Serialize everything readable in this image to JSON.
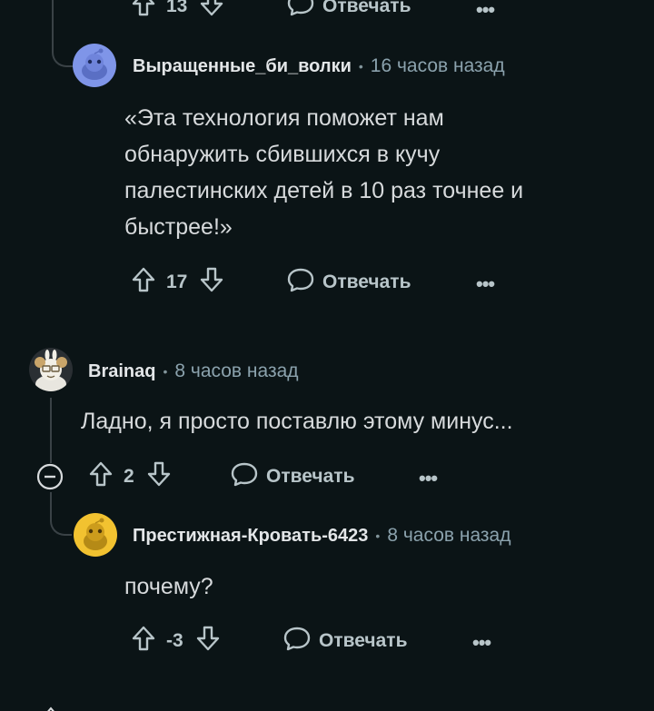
{
  "top": {
    "score": "13",
    "reply_label": "Отвечать",
    "more": "•••"
  },
  "c1": {
    "username": "Выращенные_би_волки",
    "time": "16 часов назад",
    "lines": [
      "«Эта технология поможет нам",
      "обнаружить сбившихся в кучу",
      "палестинских детей в 10 раз точнее и",
      "быстрее!»"
    ],
    "score": "17",
    "reply_label": "Отвечать",
    "more": "•••",
    "avatar_color": "#7f95e8"
  },
  "c2": {
    "username": "Brainaq",
    "time": "8 часов назад",
    "text": "Ладно, я просто поставлю этому минус...",
    "score": "2",
    "reply_label": "Отвечать",
    "more": "•••"
  },
  "c3": {
    "username": "Престижная-Кровать-6423",
    "time": "8 часов назад",
    "text": "почему?",
    "score": "-3",
    "reply_label": "Отвечать",
    "more": "•••",
    "avatar_color": "#f2c230"
  },
  "colors": {
    "background": "#0b1416",
    "text": "#d7dadc",
    "muted": "#8ba2ad",
    "line": "#3a4246"
  }
}
